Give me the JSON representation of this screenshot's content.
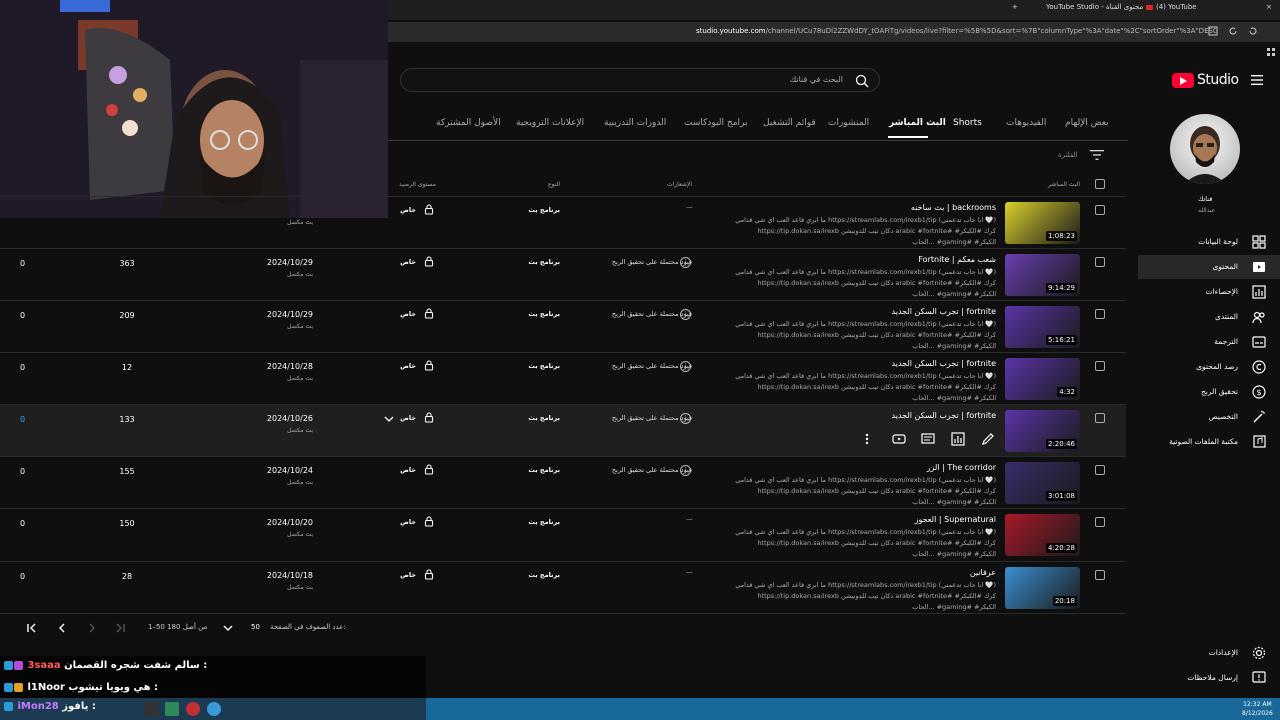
{
  "browser": {
    "tabs": [
      {
        "label": "(4) YouTube"
      },
      {
        "label": "YouTube Studio - محتوى القناة"
      }
    ],
    "url_host": "studio.youtube.com",
    "url_path": "/channel/UCu78uDl2ZZWdDY_tOAFiTg/videos/live?filter=%5B%5D&sort=%7B\"columnType\"%3A\"date\"%2C\"sortOrder\"%3A\"DESCENDING\"%7D"
  },
  "header": {
    "logo_text": "Studio",
    "search_placeholder": "البحث في قناتك"
  },
  "tabs": [
    {
      "label": "بعض الإلهام"
    },
    {
      "label": "الفيديوهات"
    },
    {
      "label": "Shorts"
    },
    {
      "label": "البث المباشر",
      "active": true
    },
    {
      "label": "المنشورات"
    },
    {
      "label": "قوائم التشغيل"
    },
    {
      "label": "برامج البودكاست"
    },
    {
      "label": "الدورات التدريبية"
    },
    {
      "label": "الإعلانات الترويجية"
    },
    {
      "label": "الأصول المشتركة"
    }
  ],
  "filter_placeholder": "الفلترة",
  "columns": {
    "live": "البث المباشر",
    "restrictions": "الإشعارات",
    "type": "النوع",
    "visibility": "مستوى الرصيد"
  },
  "rows": [
    {
      "title": "بث ساخنه | backrooms",
      "d1": "ما ابري قاعد العب اي شي قدامي https://streamlabs.com/irexb1/tip (انا حاب تدعمني 🤍)",
      "d2": "https://tip.dokan.sa/irexb دكان تيب للدونيشن arabic #fortnite# #كرك #الكبكر",
      "d3": "الحاب... #gaming# #الكبكر",
      "duration": "1:08:23",
      "restriction": "—",
      "type": "برنامج بث",
      "visibility": "خاص",
      "date": "",
      "date_sub": "بث مكتمل",
      "views": "",
      "comments": "",
      "thumb_color": "#d9cf2b"
    },
    {
      "title": "Fortnite | شعب معكم",
      "d1": "ما ابري قاعد العب اي شي قدامي https://streamlabs.com/irexb1/tip (انا حاب تدعمني 🤍)",
      "d2": "https://tip.dokan.sa/irexb دكان تيب للدونيشن arabic #fortnite# #كرك #الكبكر",
      "d3": "الحاب... #gaming# #الكبكر",
      "duration": "9:14:29",
      "restriction": "قيود محتملة على تحقيق الربح",
      "type": "برنامج بث",
      "visibility": "خاص",
      "date": "2024/10/29",
      "date_sub": "بث مكتمل",
      "views": "363",
      "comments": "0",
      "thumb_color": "#6a3fb0"
    },
    {
      "title": "تجرب السكن الجديد | fortnite",
      "d1": "ما ابري قاعد العب اي شي قدامي https://streamlabs.com/irexb1/tip (انا حاب تدعمني 🤍)",
      "d2": "https://tip.dokan.sa/irexb دكان تيب للدونيشن arabic #fortnite# #كرك #الكبكر",
      "d3": "الحاب... #gaming# #الكبكر",
      "duration": "5:16:21",
      "restriction": "قيود محتملة على تحقيق الربح",
      "type": "برنامج بث",
      "visibility": "خاص",
      "date": "2024/10/29",
      "date_sub": "بث مكتمل",
      "views": "209",
      "comments": "0",
      "thumb_color": "#5b35a8"
    },
    {
      "title": "تجرب السكن الجديد | fortnite",
      "d1": "ما ابري قاعد العب اي شي قدامي https://streamlabs.com/irexb1/tip (انا حاب تدعمني 🤍)",
      "d2": "https://tip.dokan.sa/irexb دكان تيب للدونيشن arabic #fortnite# #كرك #الكبكر",
      "d3": "الحاب... #gaming# #الكبكر",
      "duration": "4:32",
      "restriction": "قيود محتملة على تحقيق الربح",
      "type": "برنامج بث",
      "visibility": "خاص",
      "date": "2024/10/28",
      "date_sub": "بث مكتمل",
      "views": "12",
      "comments": "0",
      "thumb_color": "#5b35a8"
    },
    {
      "title": "تجرب السكن الجديد | fortnite",
      "d1": "",
      "d2": "",
      "d3": "",
      "duration": "2:20:46",
      "restriction": "قيود محتملة على تحقيق الربح",
      "type": "برنامج بث",
      "visibility": "خاص",
      "date": "2024/10/26",
      "date_sub": "بث مكتمل",
      "views": "133",
      "comments": "0",
      "thumb_color": "#5b35a8",
      "highlight": true
    },
    {
      "title": "الزر | The corridor",
      "d1": "ما ابري قاعد العب اي شي قدامي https://streamlabs.com/irexb1/tip (انا حاب تدعمني 🤍)",
      "d2": "https://tip.dokan.sa/irexb دكان تيب للدونيشن arabic #fortnite# #كرك #الكبكر",
      "d3": "الحاب... #gaming# #الكبكر",
      "duration": "3:01:08",
      "restriction": "قيود محتملة على تحقيق الربح",
      "type": "برنامج بث",
      "visibility": "خاص",
      "date": "2024/10/24",
      "date_sub": "بث مكتمل",
      "views": "155",
      "comments": "0",
      "thumb_color": "#3a2d6b"
    },
    {
      "title": "العجوز | Supernatural",
      "d1": "ما ابري قاعد العب اي شي قدامي https://streamlabs.com/irexb1/tip (انا حاب تدعمني 🤍)",
      "d2": "https://tip.dokan.sa/irexb دكان تيب للدونيشن arabic #fortnite# #كرك #الكبكر",
      "d3": "الحاب... #gaming# #الكبكر",
      "duration": "4:20:28",
      "restriction": "—",
      "type": "برنامج بث",
      "visibility": "خاص",
      "date": "2024/10/20",
      "date_sub": "بث مكتمل",
      "views": "150",
      "comments": "0",
      "thumb_color": "#a8192a"
    },
    {
      "title": "عرفانين",
      "d1": "ما ابري قاعد العب اي شي قدامي https://streamlabs.com/irexb1/tip (انا حاب تدعمني 🤍)",
      "d2": "https://tip.dokan.sa/irexb دكان تيب للدونيشن arabic #fortnite# #كرك #الكبكر",
      "d3": "الحاب... #gaming# #الكبكر",
      "duration": "20:18",
      "restriction": "—",
      "type": "برنامج بث",
      "visibility": "خاص",
      "date": "2024/10/18",
      "date_sub": "بث مكتمل",
      "views": "28",
      "comments": "0",
      "thumb_color": "#3a8fd0"
    }
  ],
  "pagination": {
    "rows_label": "عدد الصفوف في الصفحة:",
    "rows_value": "50",
    "range": "1–50 من أصل 180"
  },
  "sidebar": {
    "channel_label": "قناتك",
    "channel_name": "عبدالله",
    "items": [
      {
        "label": "لوحة البيانات"
      },
      {
        "label": "المحتوى",
        "active": true
      },
      {
        "label": "الإحصاءات"
      },
      {
        "label": "المنتدى"
      },
      {
        "label": "الترجمة"
      },
      {
        "label": "رصد المحتوى"
      },
      {
        "label": "تحقيق الربح"
      },
      {
        "label": "التخصيص"
      },
      {
        "label": "مكتبة الملفات الصوتية"
      }
    ],
    "bottom": [
      {
        "label": "الإعدادات"
      },
      {
        "label": "إرسال ملاحظات"
      }
    ]
  },
  "chat": [
    {
      "user": "3saaa",
      "message": "سالم شفت شجره القصمان :"
    },
    {
      "user": "l1Noor",
      "message": "هي ويويا تيشوب :"
    },
    {
      "user": "iMon28",
      "message": "يافوز :"
    }
  ],
  "taskbar": {
    "time": "12:32 AM",
    "date": "8/12/2026"
  },
  "colors": {
    "accent_red": "#ff0033",
    "link_blue": "#3ea6ff",
    "chat_user": "#c77dff"
  }
}
